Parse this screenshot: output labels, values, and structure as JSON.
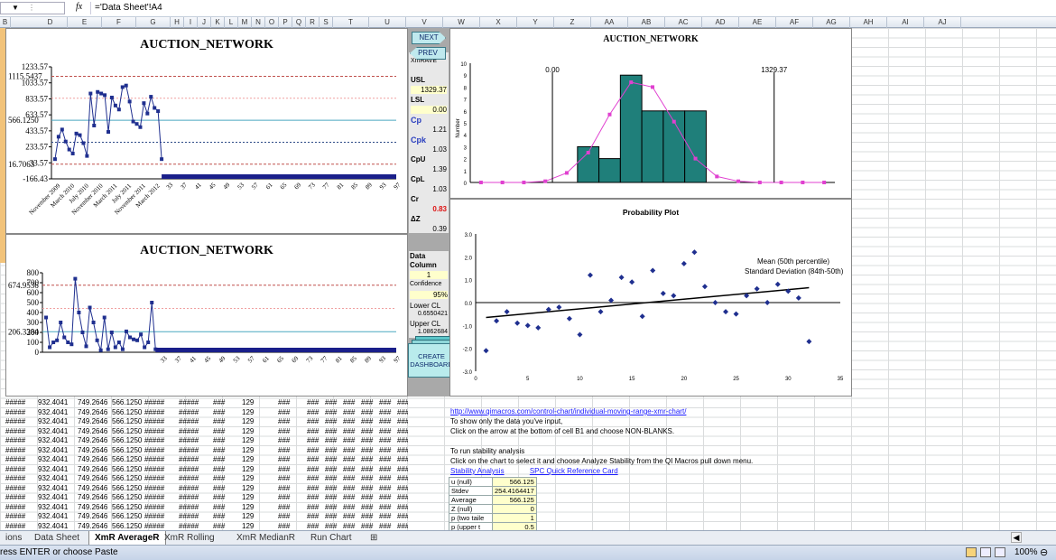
{
  "formula_bar": {
    "name_box": "",
    "fx": "fx",
    "formula": "='Data Sheet'!A4"
  },
  "columns": [
    "D",
    "E",
    "F",
    "G",
    "H",
    "I",
    "J",
    "K",
    "L",
    "M",
    "N",
    "O",
    "P",
    "Q",
    "R",
    "S",
    "T",
    "U",
    "V",
    "W",
    "X",
    "Y",
    "Z",
    "AA",
    "AB",
    "AC",
    "AD",
    "AE",
    "AF",
    "AG",
    "AH",
    "AI",
    "AJ"
  ],
  "rowstub": "B",
  "chart1": {
    "title": "AUCTION_NETWORK",
    "yticks": [
      "1233.57",
      "1033.57",
      "833.57",
      "633.57",
      "433.57",
      "233.57",
      "33.57",
      "-166.43"
    ],
    "overlays": [
      "1115.5437",
      "566.1250",
      "16.7063"
    ],
    "xlabels": [
      "November 2009",
      "March 2010",
      "July 2010",
      "November 2010",
      "March 2011",
      "July 2011",
      "November 2011",
      "March 2012"
    ],
    "xnums": [
      "33",
      "37",
      "41",
      "45",
      "49",
      "53",
      "57",
      "61",
      "65",
      "69",
      "73",
      "77",
      "81",
      "85",
      "89",
      "93",
      "97"
    ]
  },
  "chart1_data": {
    "type": "line",
    "ylim": [
      -166.43,
      1233.57
    ],
    "ucl": 1115.5437,
    "center": 566.125,
    "lcl": 16.7063,
    "values": [
      80,
      360,
      450,
      300,
      200,
      150,
      400,
      380,
      280,
      120,
      900,
      500,
      920,
      900,
      880,
      420,
      850,
      750,
      700,
      980,
      1000,
      800,
      550,
      520,
      480,
      780,
      650,
      860,
      720,
      680,
      80
    ]
  },
  "chart2": {
    "title": "AUCTION_NETWORK",
    "yticks": [
      "800",
      "700",
      "600",
      "500",
      "400",
      "300",
      "200",
      "100",
      "0"
    ],
    "overlays": [
      "674.9536",
      "206.3384"
    ],
    "xnums": [
      "33",
      "37",
      "41",
      "45",
      "49",
      "53",
      "57",
      "61",
      "65",
      "69",
      "73",
      "77",
      "81",
      "85",
      "89",
      "93",
      "97"
    ]
  },
  "chart2_data": {
    "type": "line",
    "ylim": [
      0,
      800
    ],
    "ucl": 674.9536,
    "center": 206.3384,
    "values": [
      350,
      50,
      100,
      120,
      300,
      150,
      100,
      80,
      740,
      400,
      200,
      60,
      450,
      300,
      120,
      20,
      350,
      30,
      200,
      50,
      100,
      30,
      210,
      150,
      130,
      120,
      180,
      50,
      100,
      500,
      30
    ]
  },
  "stats": {
    "xmrave": "XmRAVE",
    "usl_l": "USL",
    "usl_v": "1329.37",
    "lsl_l": "LSL",
    "lsl_v": "0.00",
    "cp_l": "Cp",
    "cp_v": "1.21",
    "cpk_l": "Cpk",
    "cpk_v": "1.03",
    "cpu_l": "CpU",
    "cpu_v": "1.39",
    "cpl_l": "CpL",
    "cpl_v": "1.03",
    "cr_l": "Cr",
    "cr_v": "0.83",
    "dz_l": "ΔZ",
    "dz_v": "0.39",
    "datacol_l": "Data Column",
    "datacol_v": "1",
    "conf_l": "Confidence",
    "conf_v": "95%",
    "lcl_l": "Lower CL",
    "lcl_v": "0.6550421",
    "ucl_l": "Upper CL",
    "ucl_v": "1.0862684"
  },
  "buttons": {
    "next": "NEXT",
    "prev": "PREV",
    "dashboard": "CREATE DASHBOARD"
  },
  "hist": {
    "title": "AUCTION_NETWORK",
    "ylabel": "Number",
    "lsl": "0.00",
    "usl": "1329.37",
    "yticks": [
      "10",
      "9",
      "8",
      "7",
      "6",
      "5",
      "4",
      "3",
      "2",
      "1",
      "0"
    ]
  },
  "hist_data": {
    "type": "bar",
    "ylim": [
      0,
      10
    ],
    "bins": [
      0,
      0,
      0,
      0,
      0,
      3,
      2,
      9,
      6,
      6,
      6,
      0,
      0,
      0,
      0,
      0,
      0
    ],
    "curve": [
      0,
      0,
      0,
      0.1,
      0.8,
      2.5,
      5.7,
      8.4,
      8.0,
      5.1,
      2.0,
      0.5,
      0.1,
      0,
      0,
      0,
      0
    ]
  },
  "prob": {
    "title": "Probability Plot",
    "legend1": "Mean (50th percentile)",
    "legend2": "Standard Deviation (84th-50th)",
    "yticks": [
      "3.0",
      "2.0",
      "1.0",
      "0.0",
      "-1.0",
      "-2.0",
      "-3.0"
    ],
    "xticks": [
      "0",
      "5",
      "10",
      "15",
      "20",
      "25",
      "30",
      "35"
    ]
  },
  "prob_data": {
    "type": "scatter",
    "xlim": [
      0,
      35
    ],
    "ylim": [
      -3,
      3
    ],
    "points": [
      [
        1,
        -2.1
      ],
      [
        2,
        -0.8
      ],
      [
        3,
        -0.4
      ],
      [
        4,
        -0.9
      ],
      [
        5,
        -1.0
      ],
      [
        6,
        -1.1
      ],
      [
        7,
        -0.3
      ],
      [
        8,
        -0.2
      ],
      [
        9,
        -0.7
      ],
      [
        10,
        -1.4
      ],
      [
        11,
        1.2
      ],
      [
        12,
        -0.4
      ],
      [
        13,
        0.1
      ],
      [
        14,
        1.1
      ],
      [
        15,
        0.9
      ],
      [
        16,
        -0.6
      ],
      [
        17,
        1.4
      ],
      [
        18,
        0.4
      ],
      [
        19,
        0.3
      ],
      [
        20,
        1.7
      ],
      [
        21,
        2.2
      ],
      [
        22,
        0.7
      ],
      [
        23,
        0.0
      ],
      [
        24,
        -0.4
      ],
      [
        25,
        -0.5
      ],
      [
        26,
        0.3
      ],
      [
        27,
        0.6
      ],
      [
        28,
        0.0
      ],
      [
        29,
        0.8
      ],
      [
        30,
        0.5
      ],
      [
        31,
        0.2
      ],
      [
        32,
        -1.7
      ]
    ],
    "trend": [
      [
        1,
        -0.65
      ],
      [
        32,
        0.65
      ]
    ]
  },
  "notes": {
    "link": "http://www.qimacros.com/control-chart/individual-moving-range-xmr-chart/",
    "l1": "To show only the data you've input,",
    "l2": "Click on the arrow at the bottom of  cell B1 and choose NON-BLANKS.",
    "l3": "To run stability analysis",
    "l4": "Click on the chart to select it and choose Analyze Stability from the QI Macros pull down menu.",
    "stab": "Stability Analysis",
    "spc": "SPC Quick Reference Card"
  },
  "stattable": [
    [
      "u (null)",
      "566.125"
    ],
    [
      "Stdev",
      "254.4164417"
    ],
    [
      "Average",
      "566.125"
    ],
    [
      "Z (null)",
      "0"
    ],
    [
      "p (two taile",
      "1"
    ],
    [
      "p (upper t",
      "0.5"
    ]
  ],
  "datarow": [
    "#####",
    "932.4041",
    "749.2646",
    "566.1250",
    "#####",
    "#####",
    "###",
    "129",
    "###",
    "###",
    "###",
    "###",
    "###",
    "###",
    "###",
    "###"
  ],
  "tabs": [
    "ions",
    "Data Sheet",
    "XmR AverageR",
    "XmR Rolling",
    "XmR MedianR",
    "Run Chart"
  ],
  "status": {
    "msg": "ress ENTER or choose Paste",
    "zoom": "100%"
  }
}
